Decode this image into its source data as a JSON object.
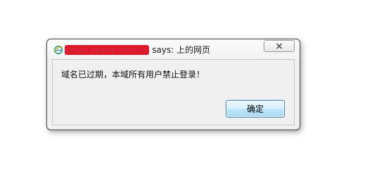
{
  "dialog": {
    "title_redacted": "email.zaabe.com.cn",
    "title_suffix": " says: 上的网页",
    "message": "域名已过期，本域所有用户禁止登录！",
    "ok_label": "确定",
    "close_icon": "close-x-icon",
    "app_icon": "ie-icon"
  },
  "colors": {
    "redaction": "#e0152a",
    "button_border": "#3c7fb1"
  }
}
